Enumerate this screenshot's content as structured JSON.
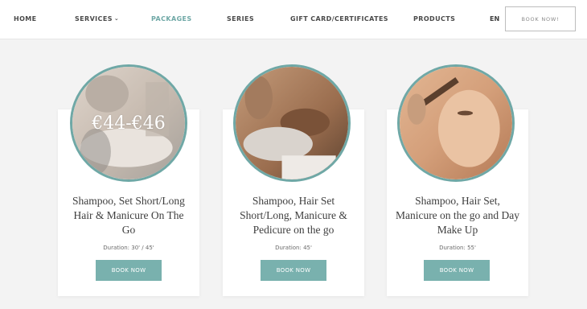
{
  "nav": {
    "items": [
      {
        "label": "HOME"
      },
      {
        "label": "SERVICES"
      },
      {
        "label": "PACKAGES"
      },
      {
        "label": "SERIES"
      },
      {
        "label": "GIFT CARD/CERTIFICATES"
      },
      {
        "label": "PRODUCTS"
      }
    ],
    "lang": "EN",
    "book_label": "BOOK NOW!",
    "active_item": "PACKAGES"
  },
  "packages": [
    {
      "price": "€44-€46",
      "title": "Shampoo, Set Short/Long Hair & Manicure On The Go",
      "duration": "Duration: 30' / 45'",
      "book_label": "BOOK NOW",
      "image": "hair-set-photo"
    },
    {
      "title": "Shampoo, Hair Set Short/Long, Manicure & Pedicure on the go",
      "duration": "Duration: 45'",
      "book_label": "BOOK NOW",
      "image": "hair-wash-photo"
    },
    {
      "title": "Shampoo, Hair Set, Manicure on the go and Day Make Up",
      "duration": "Duration: 55'",
      "book_label": "BOOK NOW",
      "image": "makeup-photo"
    }
  ],
  "colors": {
    "accent": "#79b1ae",
    "border": "#6fa8a6",
    "background": "#f3f3f3"
  }
}
